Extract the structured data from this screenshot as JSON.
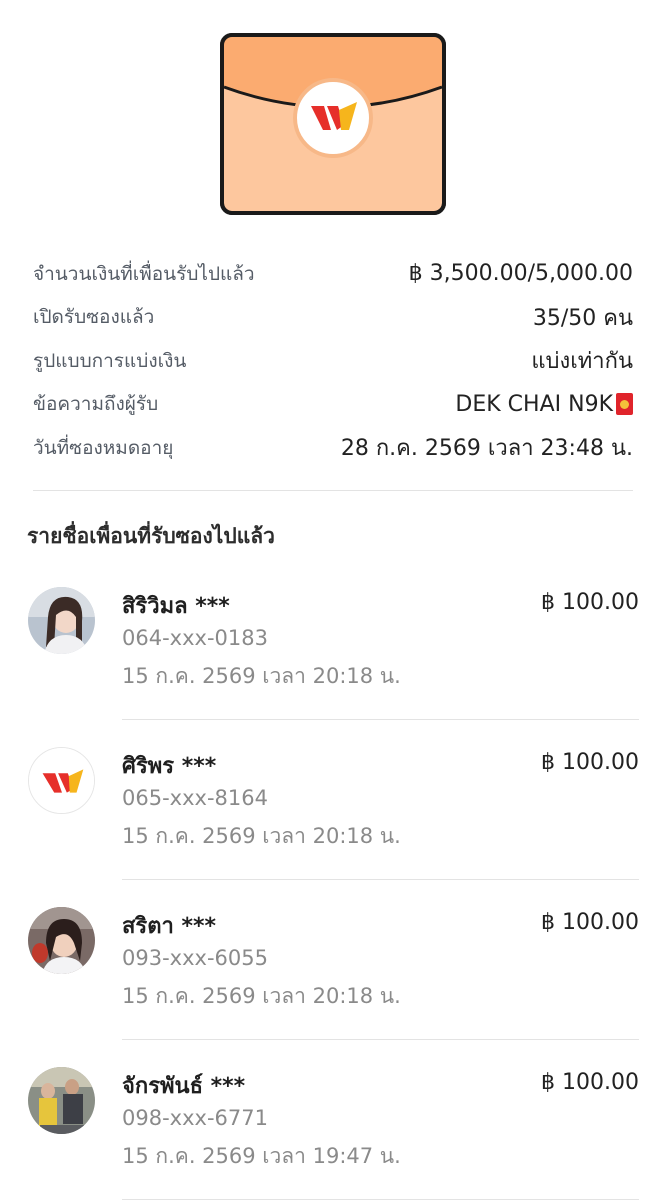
{
  "colors": {
    "envelope_fill": "#fdc79e",
    "envelope_flap": "#fbab70",
    "logo_red": "#e62f2a",
    "logo_yellow": "#f6b51c",
    "divider": "#e3e3e3"
  },
  "details": [
    {
      "label": "จำนวนเงินที่เพื่อนรับไปแล้ว",
      "value": "฿ 3,500.00/5,000.00"
    },
    {
      "label": "เปิดรับซองแล้ว",
      "value": "35/50 คน"
    },
    {
      "label": "รูปแบบการแบ่งเงิน",
      "value": "แบ่งเท่ากัน"
    },
    {
      "label": "ข้อความถึงผู้รับ",
      "value": "DEK CHAI N9K",
      "icon": "red-envelope-icon"
    },
    {
      "label": "วันที่ซองหมดอายุ",
      "value": "28 ก.ค. 2569 เวลา 23:48 น."
    }
  ],
  "list_title": "รายชื่อเพื่อนที่รับซองไปแล้ว",
  "recipients": [
    {
      "name": "สิริวิมล ***",
      "phone": "064-xxx-0183",
      "time": "15 ก.ค. 2569 เวลา 20:18 น.",
      "amount": "฿ 100.00",
      "avatar": "photo-avatar"
    },
    {
      "name": "ศิริพร ***",
      "phone": "065-xxx-8164",
      "time": "15 ก.ค. 2569 เวลา 20:18 น.",
      "amount": "฿ 100.00",
      "avatar": "logo-avatar"
    },
    {
      "name": "สริตา ***",
      "phone": "093-xxx-6055",
      "time": "15 ก.ค. 2569 เวลา 20:18 น.",
      "amount": "฿ 100.00",
      "avatar": "photo-avatar"
    },
    {
      "name": "จักรพันธ์ ***",
      "phone": "098-xxx-6771",
      "time": "15 ก.ค. 2569 เวลา 19:47 น.",
      "amount": "฿ 100.00",
      "avatar": "photo-avatar"
    }
  ]
}
